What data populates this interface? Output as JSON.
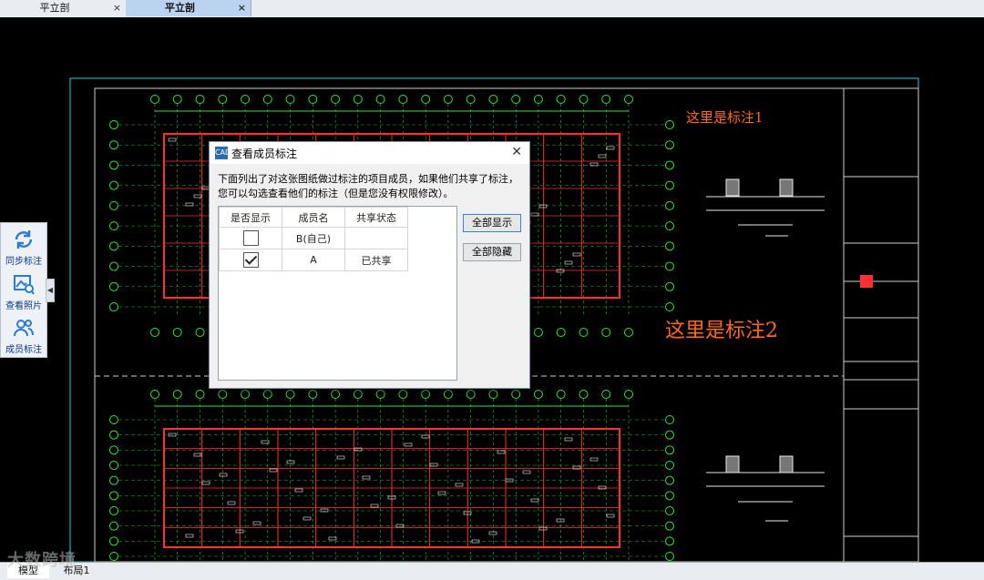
{
  "tabs": [
    {
      "label": "平立剖",
      "close": "×"
    },
    {
      "label": "平立剖",
      "close": "×"
    }
  ],
  "annotations": {
    "note1": "这里是标注1",
    "note2": "这里是标注2"
  },
  "side_panel": {
    "sync": "同步标注",
    "photos": "查看照片",
    "members": "成员标注",
    "collapse_arrow": "◀"
  },
  "dialog": {
    "title": "查看成员标注",
    "icon_text": "CAD",
    "close": "✕",
    "description": "下面列出了对这张图纸做过标注的项目成员，如果他们共享了标注，您可以勾选查看他们的标注（但是您没有权限修改）。",
    "columns": [
      "是否显示",
      "成员名",
      "共享状态"
    ],
    "rows": [
      {
        "checked": false,
        "name": "B(自己)",
        "status": ""
      },
      {
        "checked": true,
        "name": "A",
        "status": "已共享"
      }
    ],
    "show_all": "全部显示",
    "hide_all": "全部隐藏"
  },
  "layout_tabs": [
    "模型",
    "布局1"
  ],
  "watermark": "大数跨境",
  "colors": {
    "drawing_frame": "#18d4d4",
    "grid_green": "#2ee62e",
    "wall_red": "#ff3030",
    "annotation": "#ff6a1c"
  }
}
